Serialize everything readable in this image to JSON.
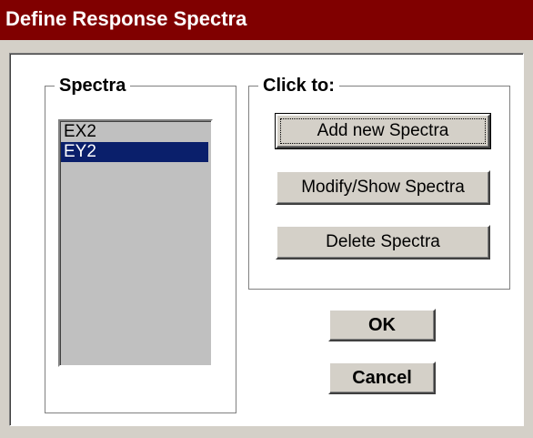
{
  "window": {
    "title": "Define Response Spectra"
  },
  "spectra_group": {
    "legend": "Spectra",
    "items": [
      {
        "label": "EX2",
        "selected": false
      },
      {
        "label": "EY2",
        "selected": true
      }
    ]
  },
  "click_group": {
    "legend": "Click to:",
    "add_label": "Add new Spectra",
    "modify_label": "Modify/Show Spectra",
    "delete_label": "Delete Spectra"
  },
  "footer": {
    "ok_label": "OK",
    "cancel_label": "Cancel"
  },
  "colors": {
    "title_bar": "#800000",
    "selection": "#0a1f6b",
    "listbox_bg": "#c0c0c0"
  }
}
